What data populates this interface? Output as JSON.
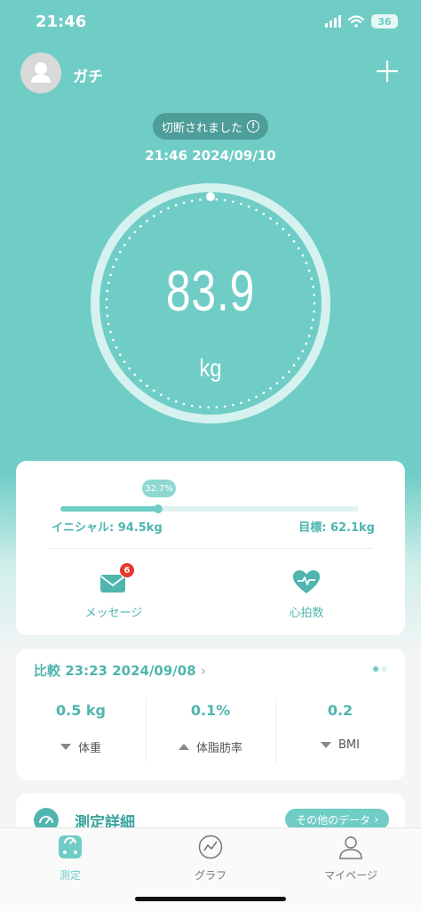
{
  "status_bar": {
    "time": "21:46",
    "battery": "36"
  },
  "header": {
    "user_name": "ガチ"
  },
  "connection": {
    "status_label": "切断されました",
    "measured_at": "21:46 2024/09/10"
  },
  "weight": {
    "value": "83.9",
    "unit": "kg"
  },
  "progress": {
    "percent_label": "32.7%",
    "fraction": 0.327,
    "initial_label": "イニシャル: 94.5kg",
    "goal_label": "目標: 62.1kg"
  },
  "quick_actions": {
    "messages_label": "メッセージ",
    "messages_badge": "6",
    "heart_rate_label": "心拍数"
  },
  "comparison": {
    "title": "比較 23:23 2024/09/08",
    "metrics": [
      {
        "value": "0.5 kg",
        "label": "体重",
        "trend": "down"
      },
      {
        "value": "0.1%",
        "label": "体脂肪率",
        "trend": "up"
      },
      {
        "value": "0.2",
        "label": "BMI",
        "trend": "down"
      }
    ]
  },
  "detail": {
    "title": "測定詳細",
    "more_button": "その他のデータ"
  },
  "nav": {
    "items": [
      {
        "label": "測定",
        "active": true
      },
      {
        "label": "グラフ",
        "active": false
      },
      {
        "label": "マイページ",
        "active": false
      }
    ]
  },
  "colors": {
    "accent": "#6fcdc6",
    "accent_text": "#4fb5ae",
    "badge": "#e8372c"
  }
}
